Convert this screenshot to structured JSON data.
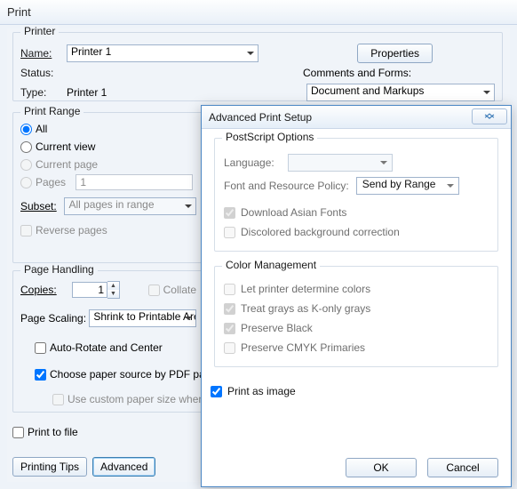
{
  "title": "Print",
  "printer": {
    "legend": "Printer",
    "name_label": "Name:",
    "name_value": "Printer 1",
    "status_label": "Status:",
    "status_value": "",
    "type_label": "Type:",
    "type_value": "Printer 1",
    "properties_btn": "Properties",
    "cf_label": "Comments and Forms:",
    "cf_value": "Document and Markups"
  },
  "range": {
    "legend": "Print Range",
    "all": "All",
    "current_view": "Current view",
    "current_page": "Current page",
    "pages": "Pages",
    "pages_value": "1",
    "subset_label": "Subset:",
    "subset_value": "All pages in range",
    "reverse": "Reverse pages"
  },
  "ph": {
    "legend": "Page Handling",
    "copies_label": "Copies:",
    "copies_value": "1",
    "collate": "Collate",
    "scaling_label": "Page Scaling:",
    "scaling_value": "Shrink to Printable Area",
    "autorotate": "Auto-Rotate and Center",
    "choose_paper": "Choose paper source by PDF page size",
    "custom_paper": "Use custom paper size when needed"
  },
  "print_to_file": "Print to file",
  "btn_tips": "Printing Tips",
  "btn_adv": "Advanced",
  "adv": {
    "title": "Advanced Print Setup",
    "ps": {
      "legend": "PostScript Options",
      "language_label": "Language:",
      "language_value": "",
      "policy_label": "Font and Resource Policy:",
      "policy_value": "Send by Range",
      "download_asian": "Download Asian Fonts",
      "discolored": "Discolored background correction"
    },
    "cm": {
      "legend": "Color Management",
      "let_printer": "Let printer determine colors",
      "konly": "Treat grays as K-only grays",
      "preserve_black": "Preserve Black",
      "preserve_cmyk": "Preserve CMYK Primaries"
    },
    "print_as_image": "Print as image",
    "ok": "OK",
    "cancel": "Cancel"
  }
}
